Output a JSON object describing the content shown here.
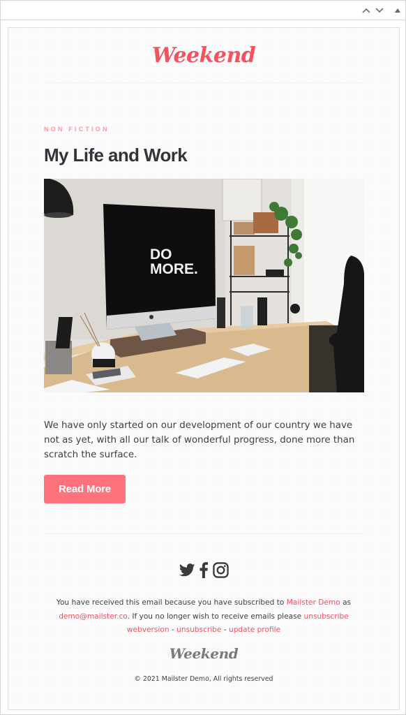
{
  "toolbar": {
    "move_up_icon": "chevron-up-icon",
    "move_down_icon": "chevron-down-icon",
    "collapse_icon": "triangle-up-icon"
  },
  "email": {
    "brand": "Weekend",
    "category": "NON FICTION",
    "title": "My Life and Work",
    "hero_image": {
      "description": "Desk with iMac showing DO MORE., keyboard, lamp, plant on shelf",
      "screen_text_line1": "DO",
      "screen_text_line2": "MORE."
    },
    "body": "We have only started on our development of our country we have not as yet, with all our talk of wonderful progress, done more than scratch the surface.",
    "cta_label": "Read More",
    "accent_color": "#f2535f",
    "button_color": "#ff737c",
    "social": [
      {
        "name": "twitter",
        "icon": "twitter-icon"
      },
      {
        "name": "facebook",
        "icon": "facebook-icon"
      },
      {
        "name": "instagram",
        "icon": "instagram-icon"
      }
    ],
    "footer": {
      "line1_prefix": "You have received this email because you have subscribed to ",
      "company_link": "Mailster Demo",
      "line1_suffix": " as",
      "email_link": "demo@mailster.co",
      "line2_text": ". If you no longer wish to receive emails please ",
      "unsubscribe_inline": "unsubscribe",
      "webversion": "webversion",
      "separator": " - ",
      "unsubscribe": "unsubscribe",
      "update_profile": "update profile"
    },
    "footer_brand": "Weekend",
    "copyright": "© 2021 Mailster Demo, All rights reserved"
  }
}
